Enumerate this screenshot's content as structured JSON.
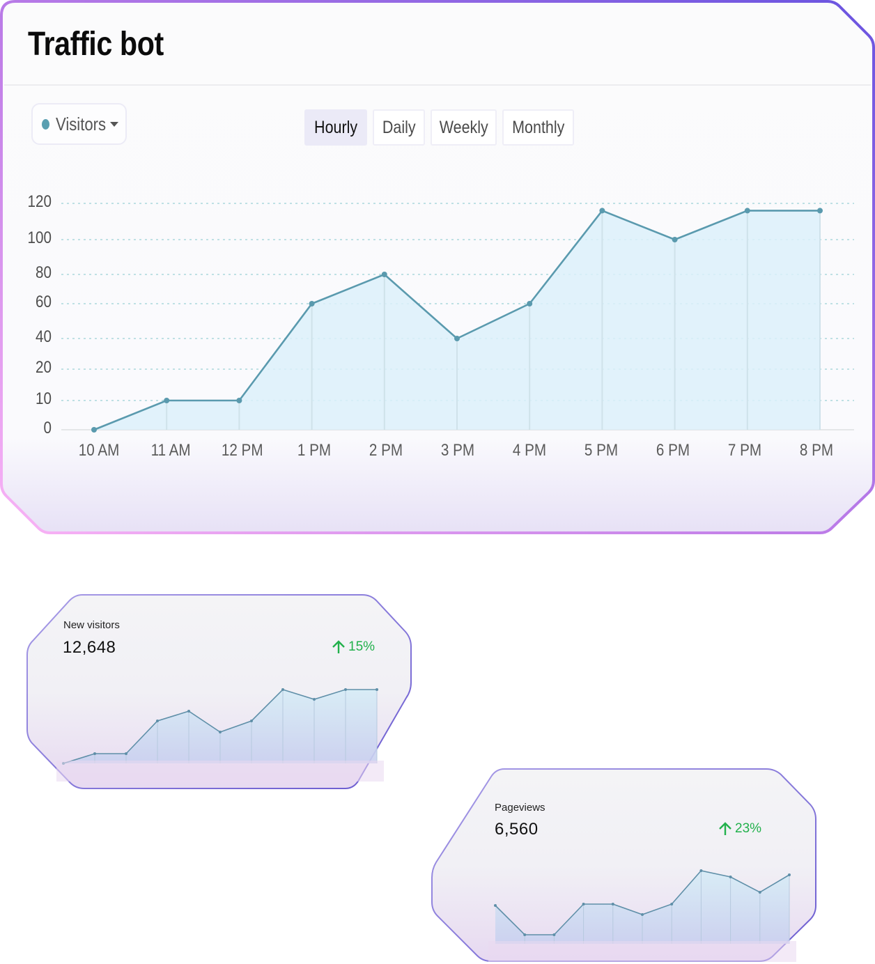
{
  "header": {
    "title": "Traffic bot"
  },
  "series_select": {
    "label": "Visitors",
    "dot_color": "#5a9fb1",
    "icon": "caret-down-icon"
  },
  "tabs": [
    {
      "label": "Hourly",
      "active": true
    },
    {
      "label": "Daily",
      "active": false
    },
    {
      "label": "Weekly",
      "active": false
    },
    {
      "label": "Monthly",
      "active": false
    }
  ],
  "colors": {
    "line": "#5a9aae",
    "fill": "#dcf0fa",
    "grid": "#a9d8dc",
    "up": "#22b14c",
    "border_pink": "#f7b2f3",
    "border_purple": "#6a54d8"
  },
  "chart_data": [
    {
      "type": "area",
      "title": "",
      "xlabel": "",
      "ylabel": "",
      "categories": [
        "10 AM",
        "11 AM",
        "12 PM",
        "1 PM",
        "2 PM",
        "3 PM",
        "4 PM",
        "5 PM",
        "6 PM",
        "7 PM",
        "8 PM"
      ],
      "series": [
        {
          "name": "Visitors",
          "values": [
            0,
            10,
            10,
            60,
            80,
            40,
            60,
            116,
            100,
            116,
            116
          ]
        }
      ],
      "yticks": [
        0,
        10,
        20,
        40,
        60,
        80,
        100,
        120
      ],
      "ylim": [
        0,
        120
      ],
      "y_scale": "categorical-ticks (0,10,20,40,...,120 equally spaced)",
      "grid": true,
      "legend": "none"
    },
    {
      "type": "area",
      "title": "New visitors sparkline",
      "series": [
        {
          "name": "New visitors",
          "values": [
            0,
            14,
            14,
            61,
            75,
            45,
            61,
            106,
            92,
            106,
            106
          ]
        }
      ],
      "ylim": [
        0,
        120
      ]
    },
    {
      "type": "area",
      "title": "Pageviews sparkline",
      "series": [
        {
          "name": "Pageviews",
          "values": [
            55,
            13,
            13,
            57,
            57,
            42,
            57,
            105,
            96,
            74,
            99
          ]
        }
      ],
      "ylim": [
        0,
        120
      ]
    }
  ],
  "cards": [
    {
      "label": "New visitors",
      "value": "12,648",
      "change": "15%",
      "trend_icon": "arrow-up-icon"
    },
    {
      "label": "Pageviews",
      "value": "6,560",
      "change": "23%",
      "trend_icon": "arrow-up-icon"
    }
  ]
}
